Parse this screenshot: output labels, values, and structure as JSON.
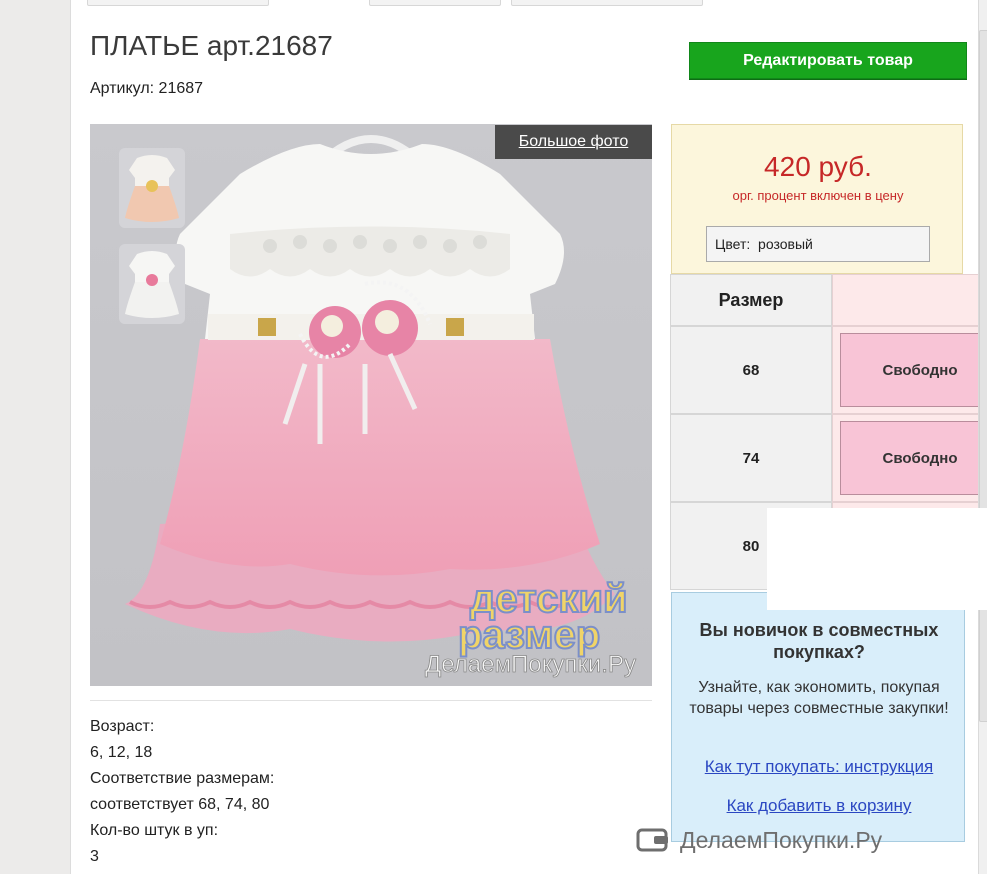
{
  "product": {
    "title": "ПЛАТЬЕ арт.21687",
    "sku_label": "Артикул:",
    "sku_value": "21687"
  },
  "toolbar": {
    "edit_label": "Редактировать товар"
  },
  "gallery": {
    "big_photo_label": "Большое фото",
    "watermark_line1": "детский",
    "watermark_line2": "размер",
    "watermark_site": "ДелаемПокупки.Ру"
  },
  "pricing": {
    "price": "420 руб.",
    "note": "орг. процент включен в цену",
    "color_label": "Цвет:",
    "color_value": "розовый",
    "price_color": "#c62828"
  },
  "sizes": {
    "header": "Размер",
    "rows": [
      {
        "size": "68",
        "status": "Свободно"
      },
      {
        "size": "74",
        "status": "Свободно"
      },
      {
        "size": "80",
        "status": ""
      }
    ]
  },
  "attributes": [
    {
      "label": "Возраст:",
      "value": "6, 12, 18"
    },
    {
      "label": "Соответствие размерам:",
      "value": "соответствует 68, 74, 80"
    },
    {
      "label": "Кол-во штук в уп:",
      "value": "3"
    }
  ],
  "newbie": {
    "title": "Вы новичок в совместных покупках?",
    "text": "Узнайте, как экономить, покупая товары через совместные закупки!",
    "link1": "Как тут покупать: инструкция",
    "link2": "Как добавить в корзину"
  },
  "footer": {
    "watermark": "ДелаемПокупки.Ру"
  },
  "colors": {
    "accent_green": "#18a51d",
    "available_pink": "#f8c4d6",
    "info_blue": "#d9eefa"
  }
}
